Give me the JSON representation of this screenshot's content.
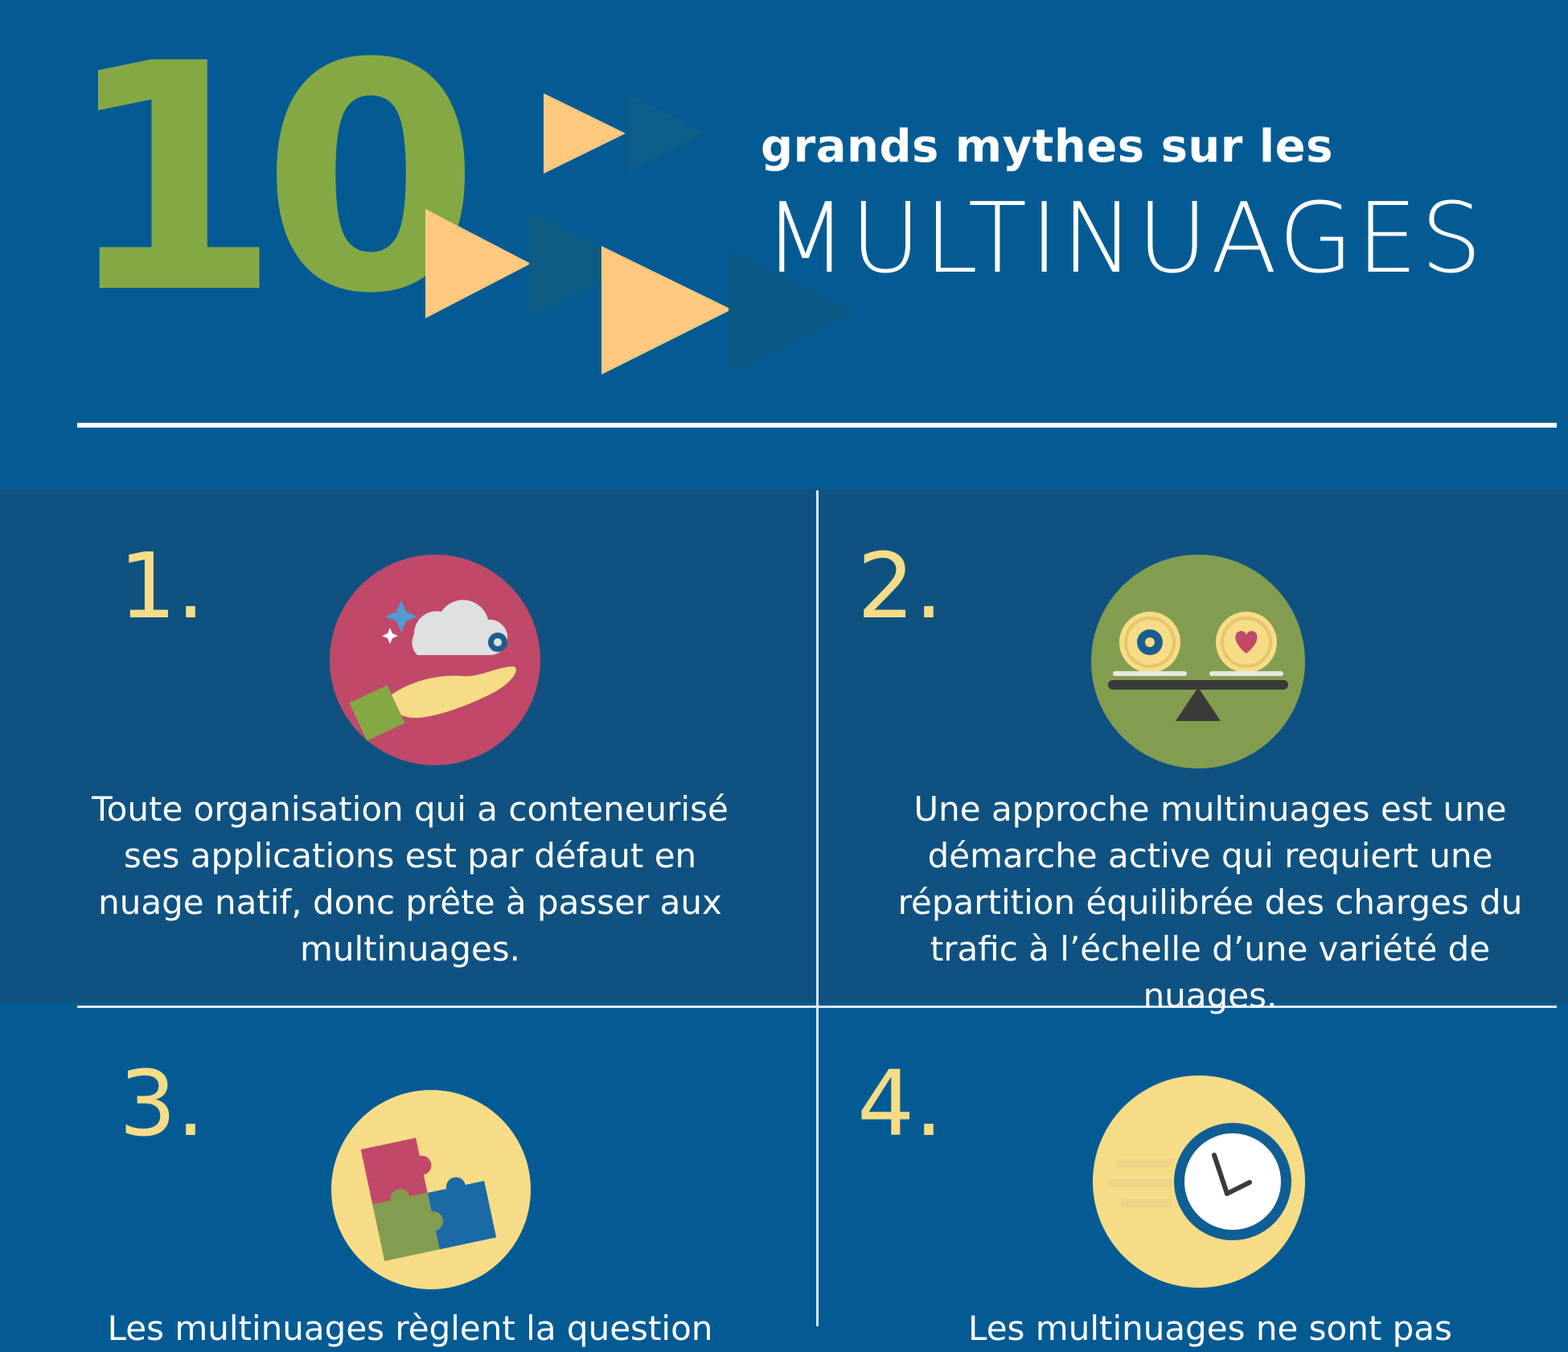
{
  "header": {
    "number": "10",
    "subtitle": "grands mythes sur les",
    "title": "MULTINUAGES"
  },
  "colors": {
    "background": "#045b94",
    "row_band": "#0f5281",
    "number_green": "#84a944",
    "accent_yellow": "#f6dc86",
    "arrow_orange": "#ffc97f"
  },
  "myths": [
    {
      "number": "1.",
      "icon": "cloud-in-hand-icon",
      "text": "Toute organisation qui a conteneurisé ses applications est par défaut en nuage natif, donc prête à passer aux multinuages."
    },
    {
      "number": "2.",
      "icon": "balance-scale-icon",
      "text": "Une approche multinuages est une démarche active qui requiert une répartition équilibrée des charges du trafic à l’échelle d’une variété de nuages."
    },
    {
      "number": "3.",
      "icon": "puzzle-icon",
      "text": "Les multinuages règlent la question"
    },
    {
      "number": "4.",
      "icon": "fast-clock-icon",
      "text": "Les multinuages ne sont pas"
    }
  ]
}
